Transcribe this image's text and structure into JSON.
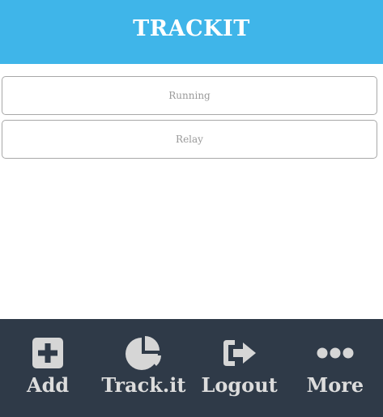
{
  "header": {
    "title": "TRACKIT"
  },
  "list": {
    "items": [
      {
        "label": "Running"
      },
      {
        "label": "Relay"
      }
    ]
  },
  "tabbar": {
    "tabs": [
      {
        "label": "Add",
        "icon": "plus-square-icon"
      },
      {
        "label": "Track.it",
        "icon": "pie-chart-icon"
      },
      {
        "label": "Logout",
        "icon": "sign-out-icon"
      },
      {
        "label": "More",
        "icon": "ellipsis-icon"
      }
    ]
  },
  "colors": {
    "header_bg": "#3fb5e9",
    "tabbar_bg": "#2f3a48",
    "tab_icon": "#d6d6d6",
    "list_border": "#a8a8a8"
  }
}
